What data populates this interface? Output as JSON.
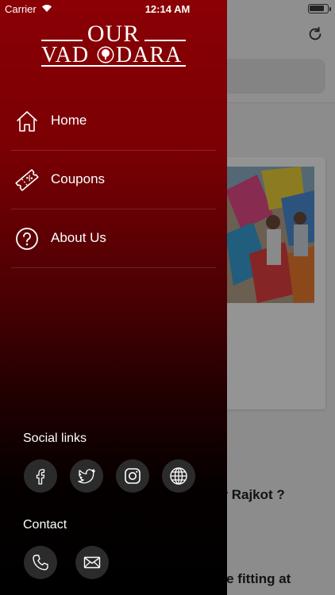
{
  "status_bar": {
    "carrier": "Carrier",
    "time": "12:14 AM"
  },
  "logo": {
    "top": "OUR",
    "bottom": "VADODARA"
  },
  "menu": [
    {
      "label": "Home",
      "icon": "home-icon"
    },
    {
      "label": "Coupons",
      "icon": "coupon-icon"
    },
    {
      "label": "About Us",
      "icon": "help-icon"
    }
  ],
  "social": {
    "title": "Social links",
    "items": [
      {
        "icon": "facebook-icon"
      },
      {
        "icon": "twitter-icon"
      },
      {
        "icon": "instagram-icon"
      },
      {
        "icon": "globe-icon"
      }
    ]
  },
  "contact": {
    "title": "Contact",
    "items": [
      {
        "icon": "phone-icon"
      },
      {
        "icon": "mail-icon"
      }
    ]
  },
  "background": {
    "headline_1": "or Rajkot ?",
    "headline_2": "ate fitting at"
  },
  "colors": {
    "drawer_top": "#8a0005",
    "drawer_bottom": "#000000",
    "button_bg": "#2b2b2b"
  }
}
